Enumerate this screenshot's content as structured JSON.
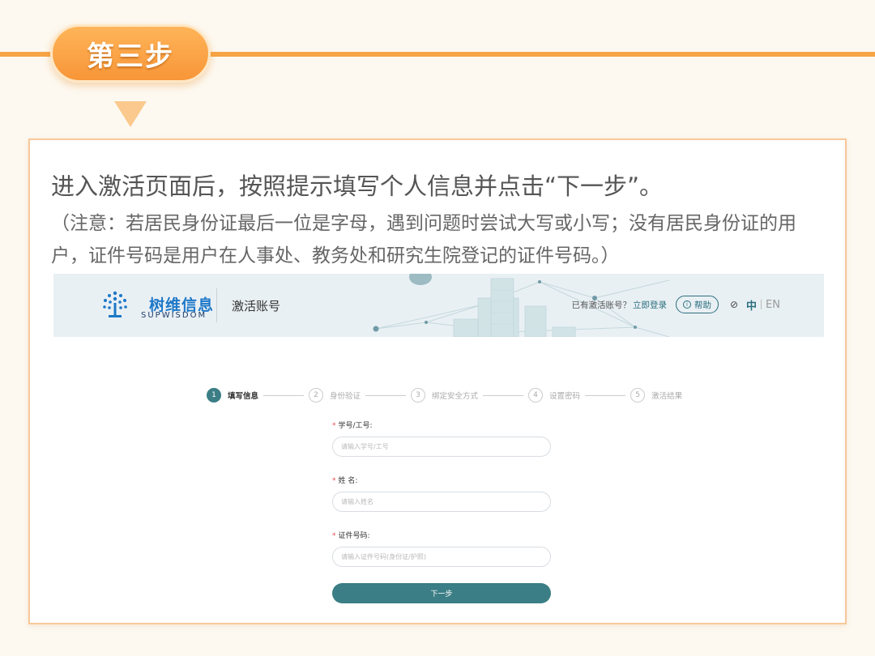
{
  "step_badge": "第三步",
  "instruction": {
    "main": "进入激活页面后，按照提示填写个人信息并点击“下一步”。",
    "note": "（注意：若居民身份证最后一位是字母，遇到问题时尝试大写或小写；没有居民身份证的用户，证件号码是用户在人事处、教务处和研究生院登记的证件号码。）"
  },
  "screenshot": {
    "header": {
      "logo_cn": "树维信息",
      "logo_en": "SUPWISDOM",
      "page_title": "激活账号",
      "activated_prompt": "已有激活账号？",
      "login_link": "立即登录",
      "help_label": "帮助",
      "lang_zh": "中",
      "lang_en": "EN"
    },
    "steps": [
      {
        "num": "1",
        "label": "填写信息",
        "active": true
      },
      {
        "num": "2",
        "label": "身份验证",
        "active": false
      },
      {
        "num": "3",
        "label": "绑定安全方式",
        "active": false
      },
      {
        "num": "4",
        "label": "设置密码",
        "active": false
      },
      {
        "num": "5",
        "label": "激活结果",
        "active": false
      }
    ],
    "form": {
      "fields": [
        {
          "label": "学号/工号:",
          "placeholder": "请输入学号/工号"
        },
        {
          "label": "姓 名:",
          "placeholder": "请输入姓名"
        },
        {
          "label": "证件号码:",
          "placeholder": "请输入证件号码(身份证/护照)"
        }
      ],
      "required_mark": "*",
      "submit_label": "下一步"
    }
  },
  "colors": {
    "accent_orange": "#f7a445",
    "teal": "#3b7e85",
    "brand_blue": "#1e78c8"
  }
}
